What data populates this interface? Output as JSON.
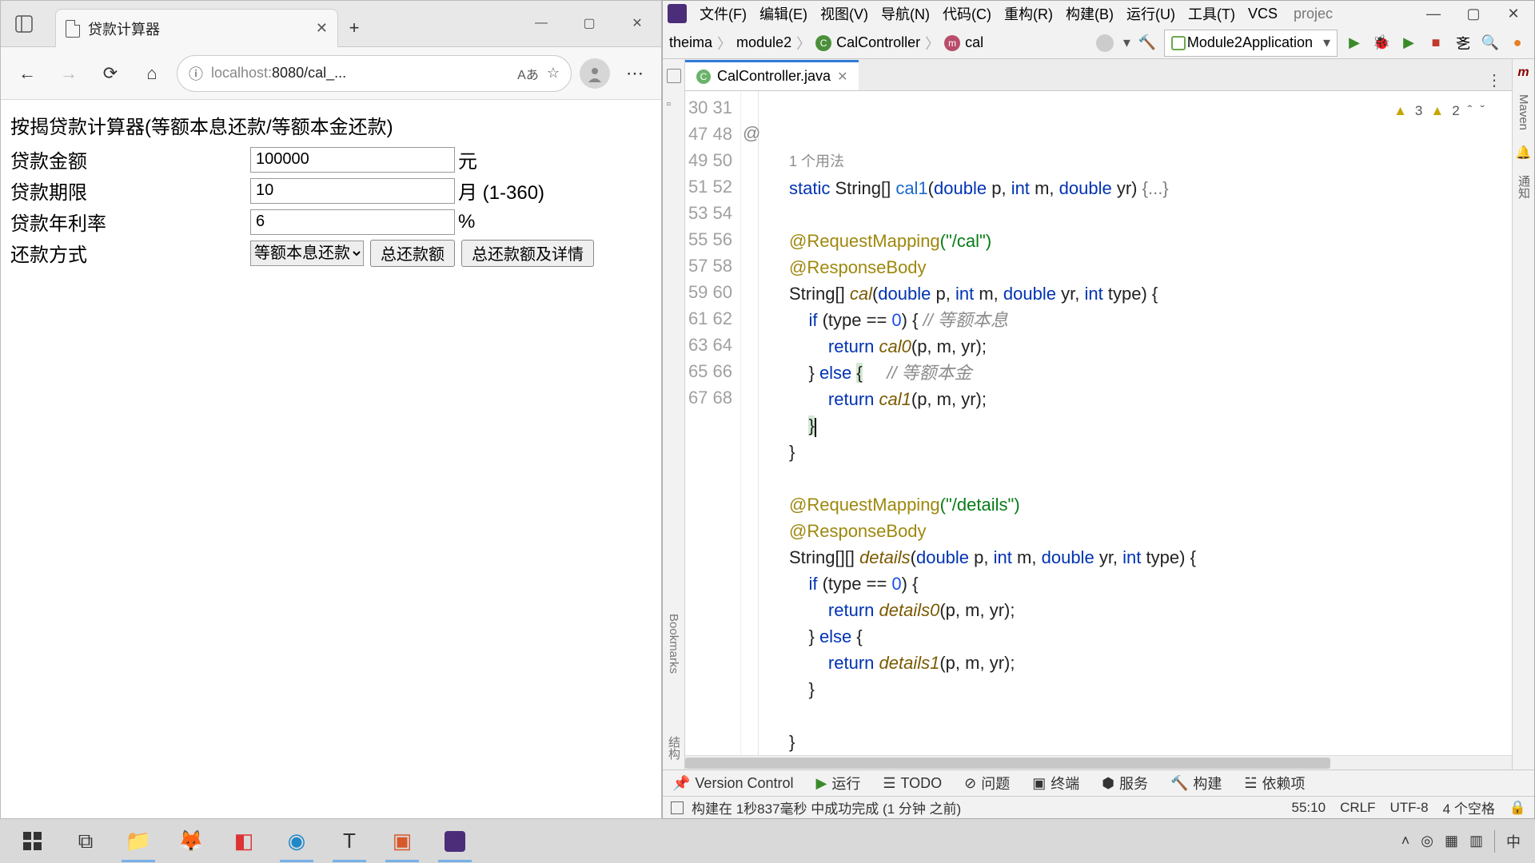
{
  "browser": {
    "tab_title": "贷款计算器",
    "url_host": "localhost:",
    "url_port_path": "8080/cal_...",
    "page": {
      "title": "按揭贷款计算器(等额本息还款/等额本金还款)",
      "amount_label": "贷款金额",
      "amount_value": "100000",
      "amount_unit": "元",
      "term_label": "贷款期限",
      "term_value": "10",
      "term_unit": "月  (1-360)",
      "rate_label": "贷款年利率",
      "rate_value": "6",
      "rate_unit": "%",
      "method_label": "还款方式",
      "method_value": "等额本息还款",
      "btn_total": "总还款额",
      "btn_details": "总还款额及详情"
    }
  },
  "ide": {
    "menu": {
      "file": "文件(F)",
      "edit": "编辑(E)",
      "view": "视图(V)",
      "nav": "导航(N)",
      "code": "代码(C)",
      "refactor": "重构(R)",
      "build": "构建(B)",
      "run": "运行(U)",
      "tools": "工具(T)",
      "vcs": "VCS",
      "proj": "projec"
    },
    "breadcrumb": {
      "p1": "theima",
      "p2": "module2",
      "p3": "CalController",
      "p4": "cal"
    },
    "run_config": "Module2Application",
    "tab_file": "CalController.java",
    "warn1": "3",
    "warn2": "2",
    "usages": "1 个用法",
    "lines": [
      "30",
      "31",
      "47",
      "48",
      "49",
      "50",
      "51",
      "52",
      "53",
      "54",
      "55",
      "56",
      "57",
      "58",
      "59",
      "60",
      "61",
      "62",
      "63",
      "64",
      "65",
      "66",
      "67",
      "68"
    ],
    "code": {
      "l31a": "static",
      "l31b": "String[]",
      "l31c": "cal1",
      "l31d": "double",
      "l31e": "p,",
      "l31f": "int",
      "l31g": "m,",
      "l31h": "double",
      "l31i": "yr)",
      "l31j": "{...}",
      "l48a": "@RequestMapping",
      "l48b": "(\"/cal\")",
      "l49": "@ResponseBody",
      "l50a": "String[]",
      "l50b": "cal",
      "l50c": "double",
      "l50d": "p,",
      "l50e": "int",
      "l50f": "m,",
      "l50g": "double",
      "l50h": "yr,",
      "l50i": "int",
      "l50j": "type) {",
      "l51a": "if",
      "l51b": "(type ==",
      "l51c": "0",
      "l51d": ") {",
      "l51e": "// 等额本息",
      "l52a": "return",
      "l52b": "cal0",
      "l52c": "(p, m, yr);",
      "l53a": "}",
      "l53b": "else",
      "l53c": "{",
      "l53d": "// 等额本金",
      "l54a": "return",
      "l54b": "cal1",
      "l54c": "(p, m, yr);",
      "l55": "}",
      "l56": "}",
      "l58a": "@RequestMapping",
      "l58b": "(\"/details\")",
      "l59": "@ResponseBody",
      "l60a": "String[][]",
      "l60b": "details",
      "l60c": "double",
      "l60d": "p,",
      "l60e": "int",
      "l60f": "m,",
      "l60g": "double",
      "l60h": "yr,",
      "l60i": "int",
      "l60j": "type) {",
      "l61a": "if",
      "l61b": "(type ==",
      "l61c": "0",
      "l61d": ") {",
      "l62a": "return",
      "l62b": "details0",
      "l62c": "(p, m, yr);",
      "l63a": "}",
      "l63b": "else",
      "l63c": "{",
      "l64a": "return",
      "l64b": "details1",
      "l64c": "(p, m, yr);",
      "l65": "}",
      "l67": "}"
    },
    "bottom": {
      "vc": "Version Control",
      "run": "运行",
      "todo": "TODO",
      "problems": "问题",
      "terminal": "终端",
      "services": "服务",
      "build": "构建",
      "deps": "依赖项"
    },
    "status_msg": "构建在 1秒837毫秒 中成功完成 (1 分钟 之前)",
    "status_pos": "55:10",
    "status_eol": "CRLF",
    "status_enc": "UTF-8",
    "status_indent": "4 个空格",
    "right_panel": {
      "maven": "Maven",
      "notify": "通知"
    }
  },
  "taskbar": {
    "ime": "中"
  }
}
